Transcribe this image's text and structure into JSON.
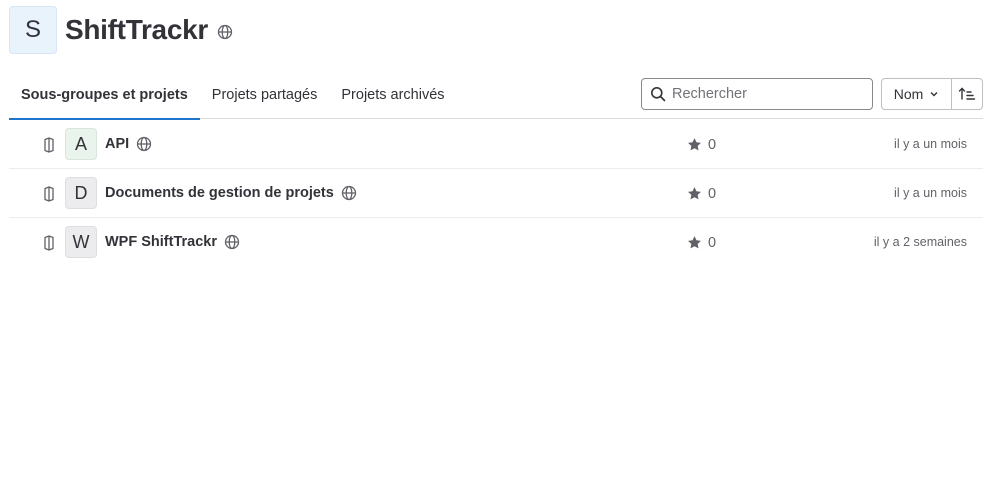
{
  "group": {
    "avatar_letter": "S",
    "name": "ShiftTrackr",
    "visibility_icon": "globe-icon"
  },
  "tabs": [
    {
      "label": "Sous-groupes et projets",
      "active": true
    },
    {
      "label": "Projets partagés",
      "active": false
    },
    {
      "label": "Projets archivés",
      "active": false
    }
  ],
  "search": {
    "placeholder": "Rechercher",
    "value": ""
  },
  "sort": {
    "label": "Nom",
    "direction_icon": "sort-ascending-icon"
  },
  "projects": [
    {
      "avatar_letter": "A",
      "avatar_color": "#e8f4ec",
      "name": "API",
      "stars": "0",
      "updated": "il y a un mois"
    },
    {
      "avatar_letter": "D",
      "avatar_color": "#ececef",
      "name": "Documents de gestion de projets",
      "stars": "0",
      "updated": "il y a un mois"
    },
    {
      "avatar_letter": "W",
      "avatar_color": "#ececef",
      "name": "WPF ShiftTrackr",
      "stars": "0",
      "updated": "il y a 2 semaines"
    }
  ],
  "colors": {
    "accent": "#1f75cb",
    "text": "#333238",
    "muted": "#626168"
  }
}
